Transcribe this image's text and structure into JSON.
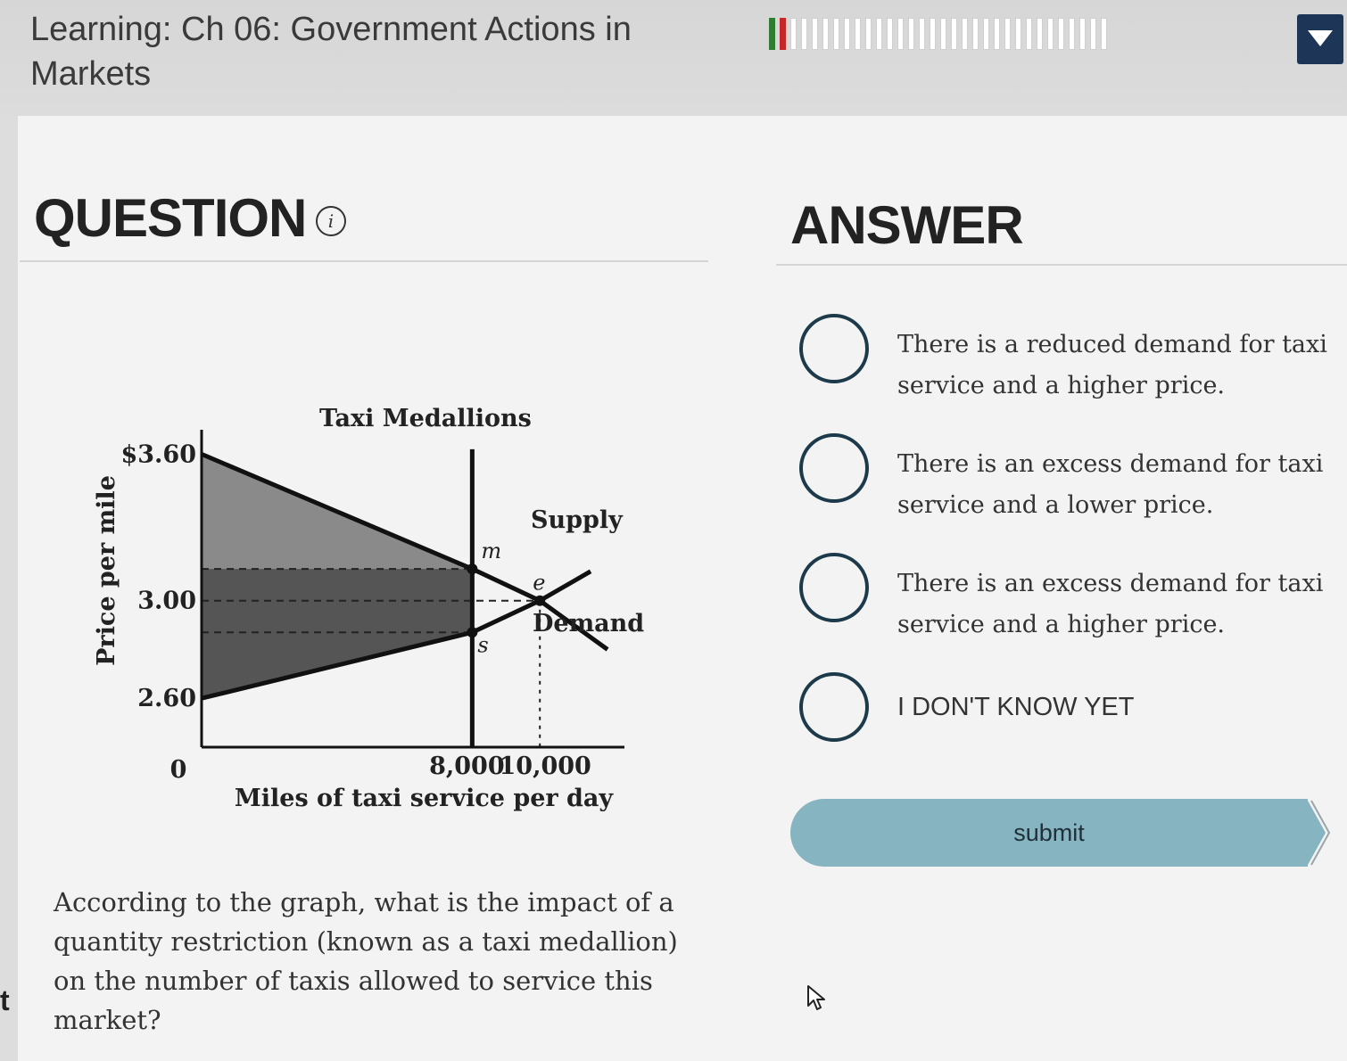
{
  "header": {
    "course_title": "Learning: Ch 06: Government Actions in Markets",
    "progress": {
      "correct": 1,
      "incorrect": 1,
      "remaining": 30
    }
  },
  "question": {
    "heading": "QUESTION",
    "info_glyph": "i",
    "text": "According to the graph, what is the impact of a quantity restriction (known as a taxi medallion) on the number of taxis allowed to service this market?"
  },
  "answer": {
    "heading": "ANSWER",
    "options": [
      {
        "label": "There is a reduced demand for taxi service and a higher price."
      },
      {
        "label": "There is an excess demand for taxi service and a lower price."
      },
      {
        "label": "There is an excess demand for taxi service and a higher price."
      },
      {
        "label": "I DON'T KNOW YET"
      }
    ],
    "submit_label": "submit"
  },
  "edge_text": "t",
  "chart_data": {
    "type": "line",
    "title": "Taxi Medallions",
    "xlabel": "Miles of taxi service per day",
    "ylabel": "Price per mile",
    "x_ticks": [
      "0",
      "8,000",
      "10,000"
    ],
    "y_ticks": [
      "$3.60",
      "3.00",
      "2.60"
    ],
    "series": [
      {
        "name": "Supply",
        "points": [
          [
            0,
            2.6
          ],
          [
            8000,
            2.87
          ],
          [
            10000,
            3.0
          ],
          [
            11500,
            3.12
          ]
        ]
      },
      {
        "name": "Demand",
        "points": [
          [
            0,
            3.6
          ],
          [
            8000,
            3.13
          ],
          [
            10000,
            3.0
          ],
          [
            12000,
            2.8
          ]
        ]
      }
    ],
    "points": [
      {
        "label": "m",
        "x": 8000,
        "y": 3.13
      },
      {
        "label": "s",
        "x": 8000,
        "y": 2.87
      },
      {
        "label": "e",
        "x": 10000,
        "y": 3.0
      }
    ],
    "quota": {
      "x": 8000
    },
    "shaded_area": "wedge between demand and supply from 0 to 8,000",
    "xlim": [
      0,
      12500
    ],
    "ylim": [
      2.4,
      3.7
    ],
    "grid": false
  },
  "colors": {
    "accent": "#1d3557",
    "submit": "#86b4c0",
    "progress_correct": "#2e7d32",
    "progress_incorrect": "#c62828"
  }
}
